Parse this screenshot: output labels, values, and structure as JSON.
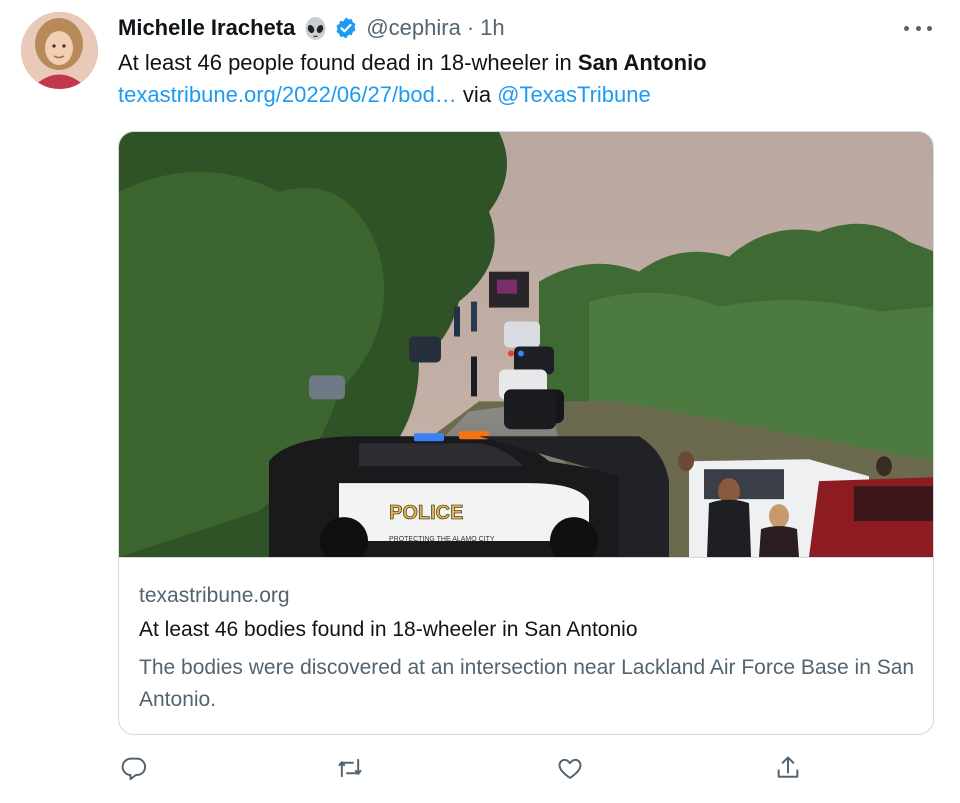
{
  "tweet": {
    "author_name": "Michelle Iracheta",
    "handle": "@cephira",
    "separator": "·",
    "time": "1h",
    "text_prefix": "At least 46 people found dead in 18-wheeler in ",
    "text_bold": "San Antonio",
    "link_text": "texastribune.org/2022/06/27/bod…",
    "via_text": " via ",
    "mention": "@TexasTribune"
  },
  "card": {
    "domain": "texastribune.org",
    "title": "At least 46 bodies found in 18-wheeler in San Antonio",
    "description": "The bodies were discovered at an intersection near Lackland Air Force Base in San Antonio.",
    "image_text_police": "POLICE",
    "image_text_slogan": "PROTECTING THE ALAMO CITY"
  },
  "icons": {
    "badge_emoji": "alien-icon",
    "verified": "verified-badge-icon",
    "more": "more-options-icon",
    "reply": "reply-icon",
    "retweet": "retweet-icon",
    "like": "like-icon",
    "share": "share-icon"
  },
  "colors": {
    "link": "#1d9bf0",
    "secondary_text": "#536471",
    "primary_text": "#0f1419",
    "border": "#cfd9de"
  }
}
